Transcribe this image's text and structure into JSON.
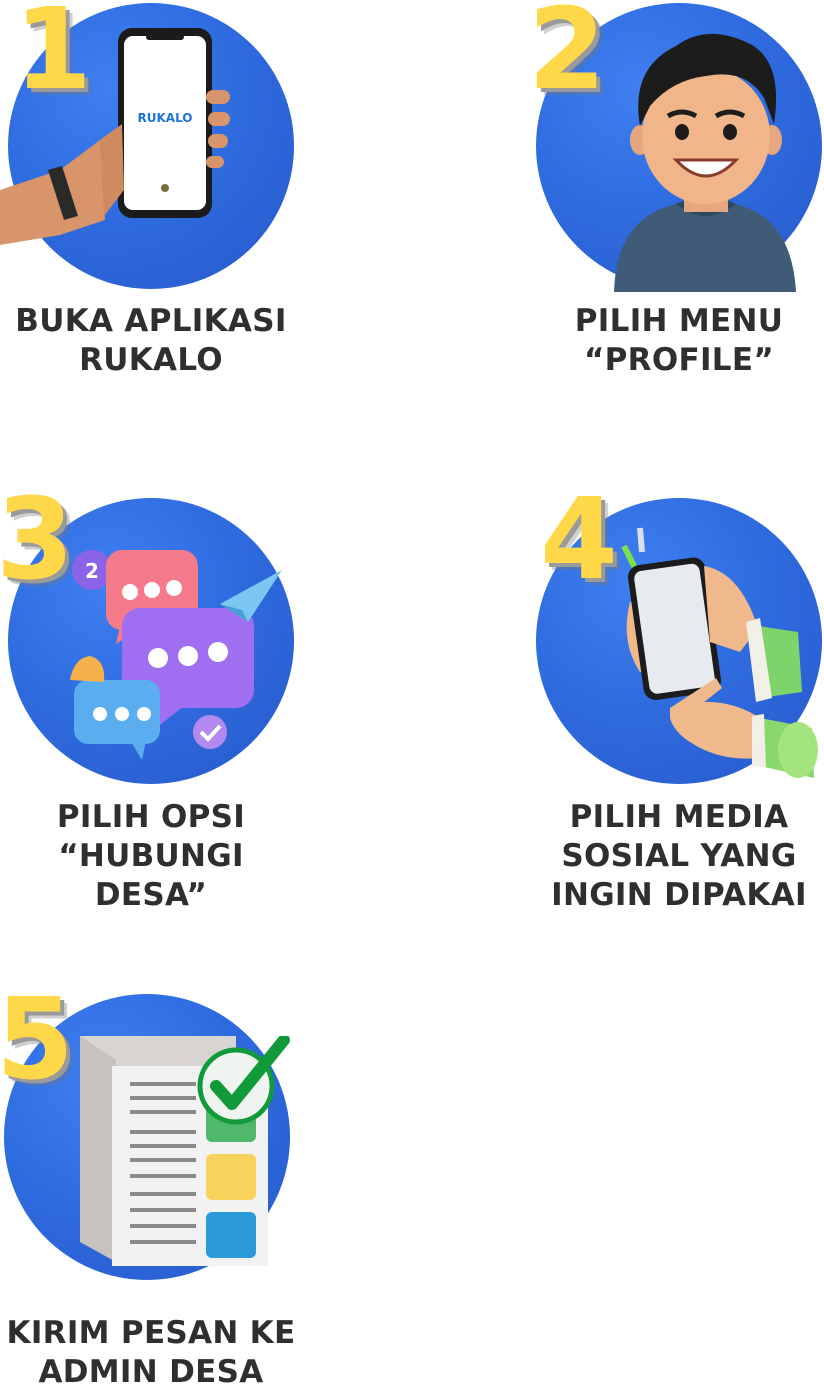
{
  "steps": [
    {
      "number": "1",
      "lines": [
        "BUKA APLIKASI",
        "RUKALO"
      ],
      "app_logo": "RUKALO"
    },
    {
      "number": "2",
      "lines": [
        "PILIH MENU",
        "“PROFILE”"
      ]
    },
    {
      "number": "3",
      "lines": [
        "PILIH OPSI",
        "“HUBUNGI DESA”"
      ],
      "badge": "2"
    },
    {
      "number": "4",
      "lines": [
        "PILIH MEDIA",
        "SOSIAL YANG",
        "INGIN DIPAKAI"
      ]
    },
    {
      "number": "5",
      "lines": [
        "KIRIM PESAN KE",
        "ADMIN DESA"
      ]
    }
  ],
  "colors": {
    "circle": "#2f6ce0",
    "number": "#ffd84a",
    "text": "#2f2f2f"
  },
  "icons": [
    "phone-hand-icon",
    "smiling-man-icon",
    "chat-bubbles-icon",
    "hand-tapping-phone-icon",
    "checklist-document-icon"
  ]
}
